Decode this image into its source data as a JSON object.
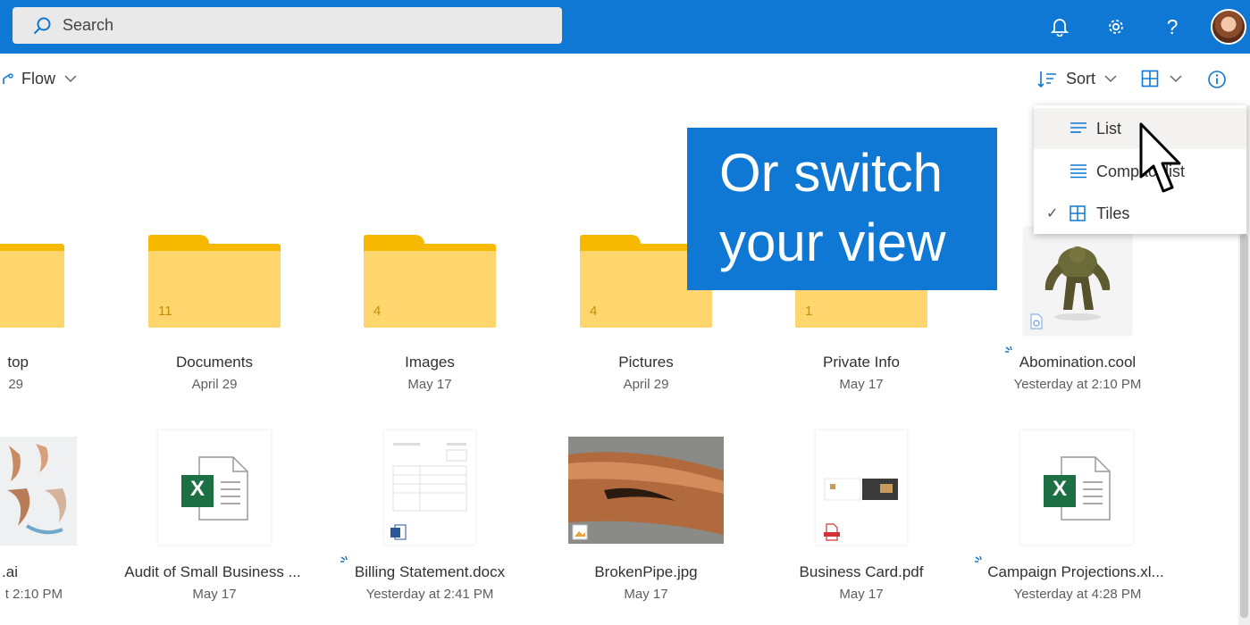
{
  "header": {
    "search_placeholder": "Search",
    "icons": [
      "bell-icon",
      "gear-icon",
      "help-icon",
      "avatar"
    ],
    "help_glyph": "?",
    "brand_color": "#0f78d4"
  },
  "command_bar": {
    "flow_label": "Flow",
    "sort_label": "Sort"
  },
  "view_menu": {
    "items": [
      {
        "label": "List",
        "icon": "list-icon",
        "checked": false
      },
      {
        "label": "Compact list",
        "icon": "compact-list-icon",
        "checked": false
      },
      {
        "label": "Tiles",
        "icon": "tiles-icon",
        "checked": true
      }
    ],
    "check_glyph": "✓"
  },
  "callout": {
    "line1": "Or switch",
    "line2": "your view"
  },
  "folders": [
    {
      "name": "top",
      "date": "29",
      "count": ""
    },
    {
      "name": "Documents",
      "date": "April 29",
      "count": "11"
    },
    {
      "name": "Images",
      "date": "May 17",
      "count": "4"
    },
    {
      "name": "Pictures",
      "date": "April 29",
      "count": "4"
    },
    {
      "name": "Private Info",
      "date": "May 17",
      "count": "1"
    }
  ],
  "row1_file": {
    "name": "Abomination.cool",
    "date": "Yesterday at 2:10 PM"
  },
  "files": [
    {
      "name": ".ai",
      "date": "t 2:10 PM"
    },
    {
      "name": "Audit of Small Business ...",
      "date": "May 17"
    },
    {
      "name": "Billing Statement.docx",
      "date": "Yesterday at 2:41 PM"
    },
    {
      "name": "BrokenPipe.jpg",
      "date": "May 17"
    },
    {
      "name": "Business Card.pdf",
      "date": "May 17"
    },
    {
      "name": "Campaign Projections.xl...",
      "date": "Yesterday at 4:28 PM"
    }
  ],
  "excel_letter": "X"
}
